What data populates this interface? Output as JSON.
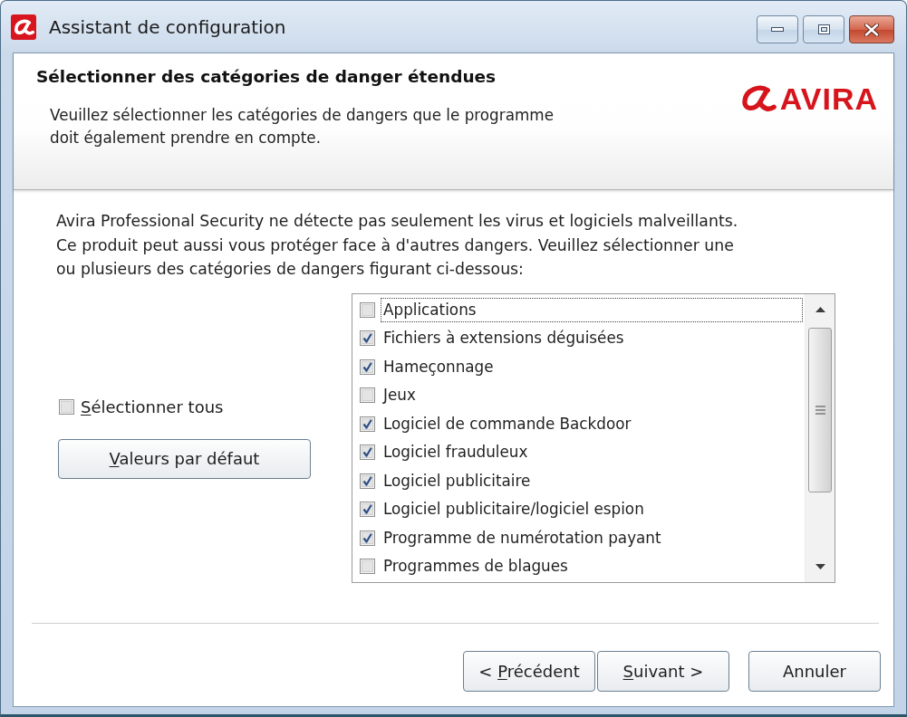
{
  "window": {
    "title": "Assistant de configuration"
  },
  "header": {
    "title": "Sélectionner des catégories de danger étendues",
    "description": "Veuillez sélectionner les catégories de dangers que le programme\ndoit également prendre en compte.",
    "logo": "AVIRA"
  },
  "intro": "Avira Professional Security ne détecte pas seulement les virus et logiciels malveillants.\nCe produit peut aussi vous protéger face à d'autres dangers. Veuillez sélectionner une\nou plusieurs des catégories de dangers figurant ci-dessous:",
  "select_all": {
    "label": "Sélectionner tous",
    "access_key_underlined": true,
    "checked": false
  },
  "defaults_button": {
    "label": "Valeurs par défaut",
    "access_key_underlined": true
  },
  "categories": [
    {
      "label": "Applications",
      "checked": false,
      "focused": true
    },
    {
      "label": "Fichiers à extensions déguisées",
      "checked": true,
      "focused": false
    },
    {
      "label": "Hameçonnage",
      "checked": true,
      "focused": false
    },
    {
      "label": "Jeux",
      "checked": false,
      "focused": false
    },
    {
      "label": "Logiciel de commande Backdoor",
      "checked": true,
      "focused": false
    },
    {
      "label": "Logiciel frauduleux",
      "checked": true,
      "focused": false
    },
    {
      "label": "Logiciel publicitaire",
      "checked": true,
      "focused": false
    },
    {
      "label": "Logiciel publicitaire/logiciel espion",
      "checked": true,
      "focused": false
    },
    {
      "label": "Programme de numérotation payant",
      "checked": true,
      "focused": false
    },
    {
      "label": "Programmes de blagues",
      "checked": false,
      "focused": false
    }
  ],
  "buttons": [
    {
      "label": "< Précédent",
      "access_key_underlined": true
    },
    {
      "label": "Suivant >",
      "access_key_underlined": true
    },
    {
      "label": "Annuler",
      "access_key_underlined": false
    }
  ]
}
